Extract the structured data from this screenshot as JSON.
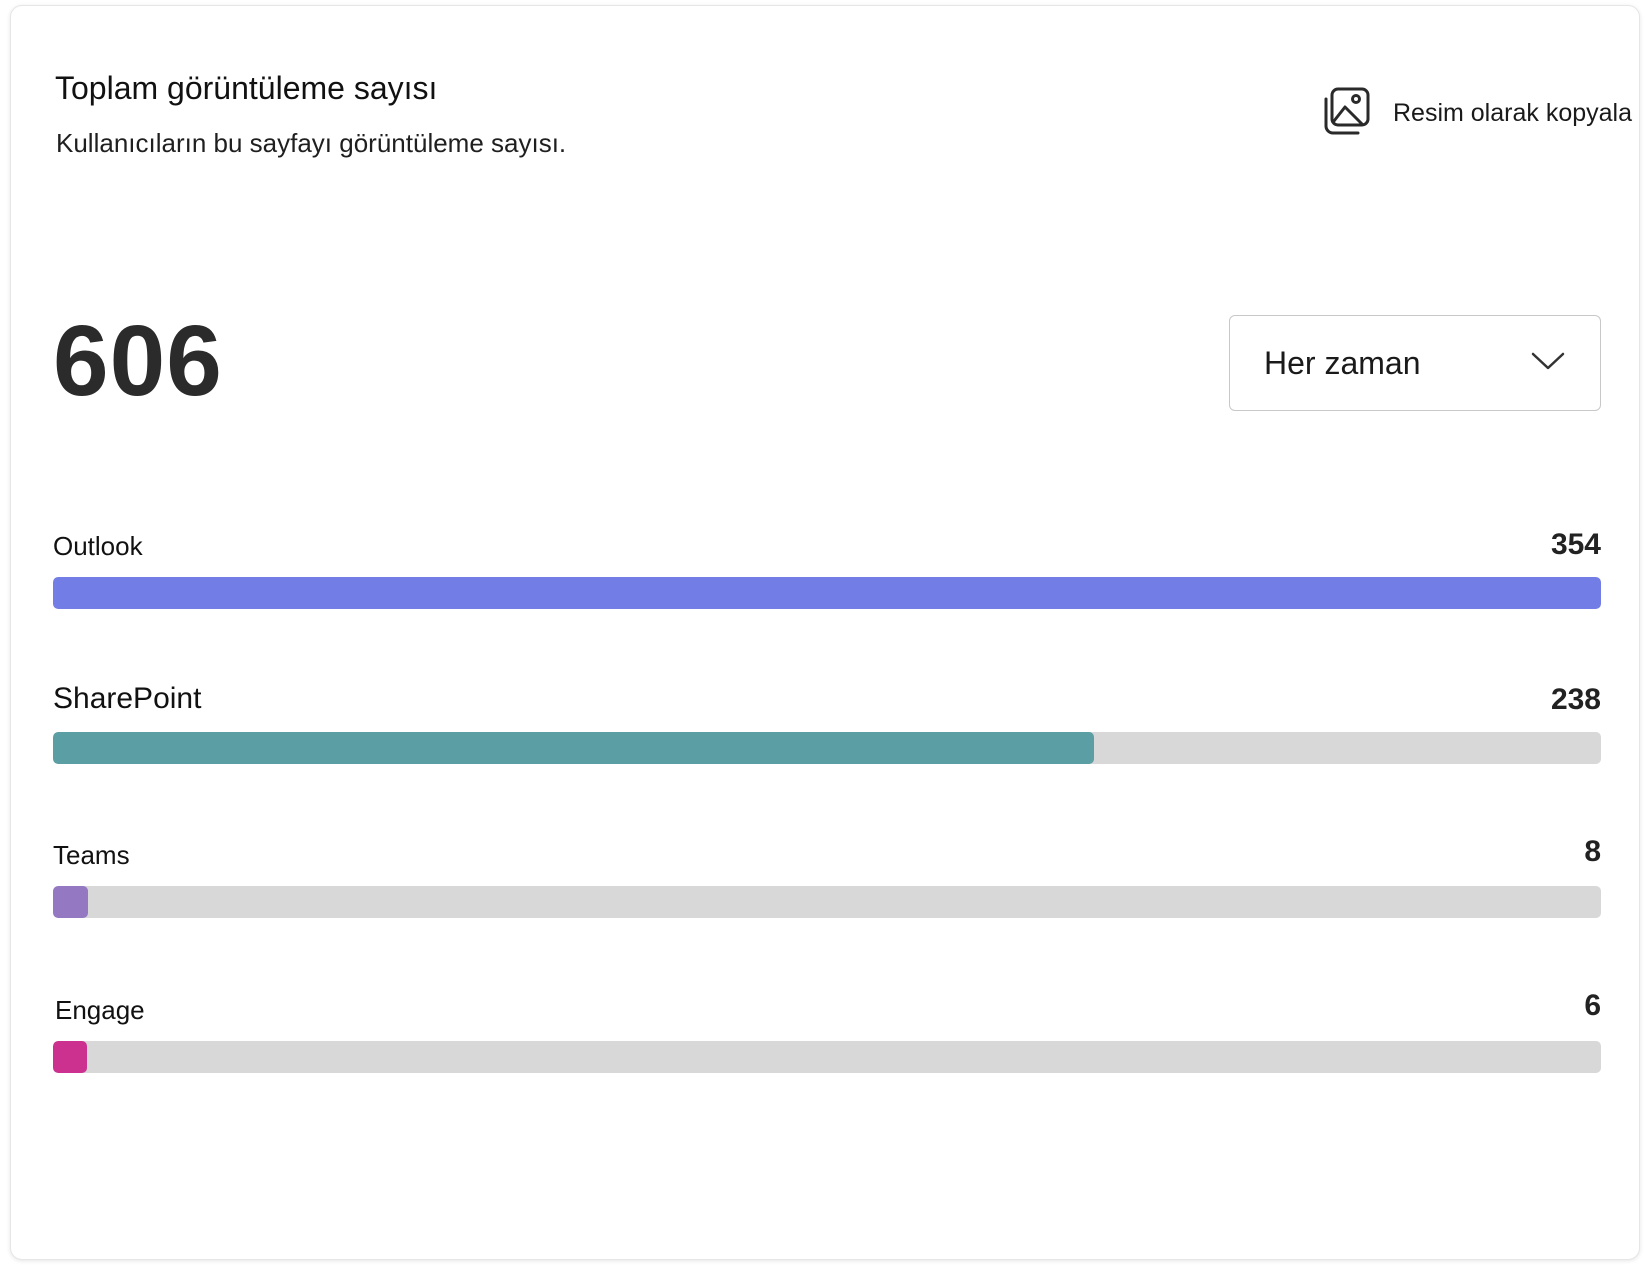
{
  "header": {
    "title": "Toplam görüntüleme sayısı",
    "subtitle": "Kullanıcıların bu sayfayı görüntüleme sayısı.",
    "copy_label": "Resim olarak kopyala",
    "copy_icon": "image-copy-icon"
  },
  "summary": {
    "total": "606"
  },
  "filter": {
    "selected": "Her zaman",
    "icon": "chevron-down-icon"
  },
  "chart_data": {
    "type": "bar",
    "orientation": "horizontal",
    "categories": [
      "Outlook",
      "SharePoint",
      "Teams",
      "Engage"
    ],
    "values": [
      354,
      238,
      8,
      6
    ],
    "value_labels": [
      "354",
      "238",
      "8",
      "6"
    ],
    "max": 354,
    "colors": [
      "#737de6",
      "#5b9ea3",
      "#9478c1",
      "#cc3190"
    ],
    "track_color": "#d8d8d8"
  }
}
